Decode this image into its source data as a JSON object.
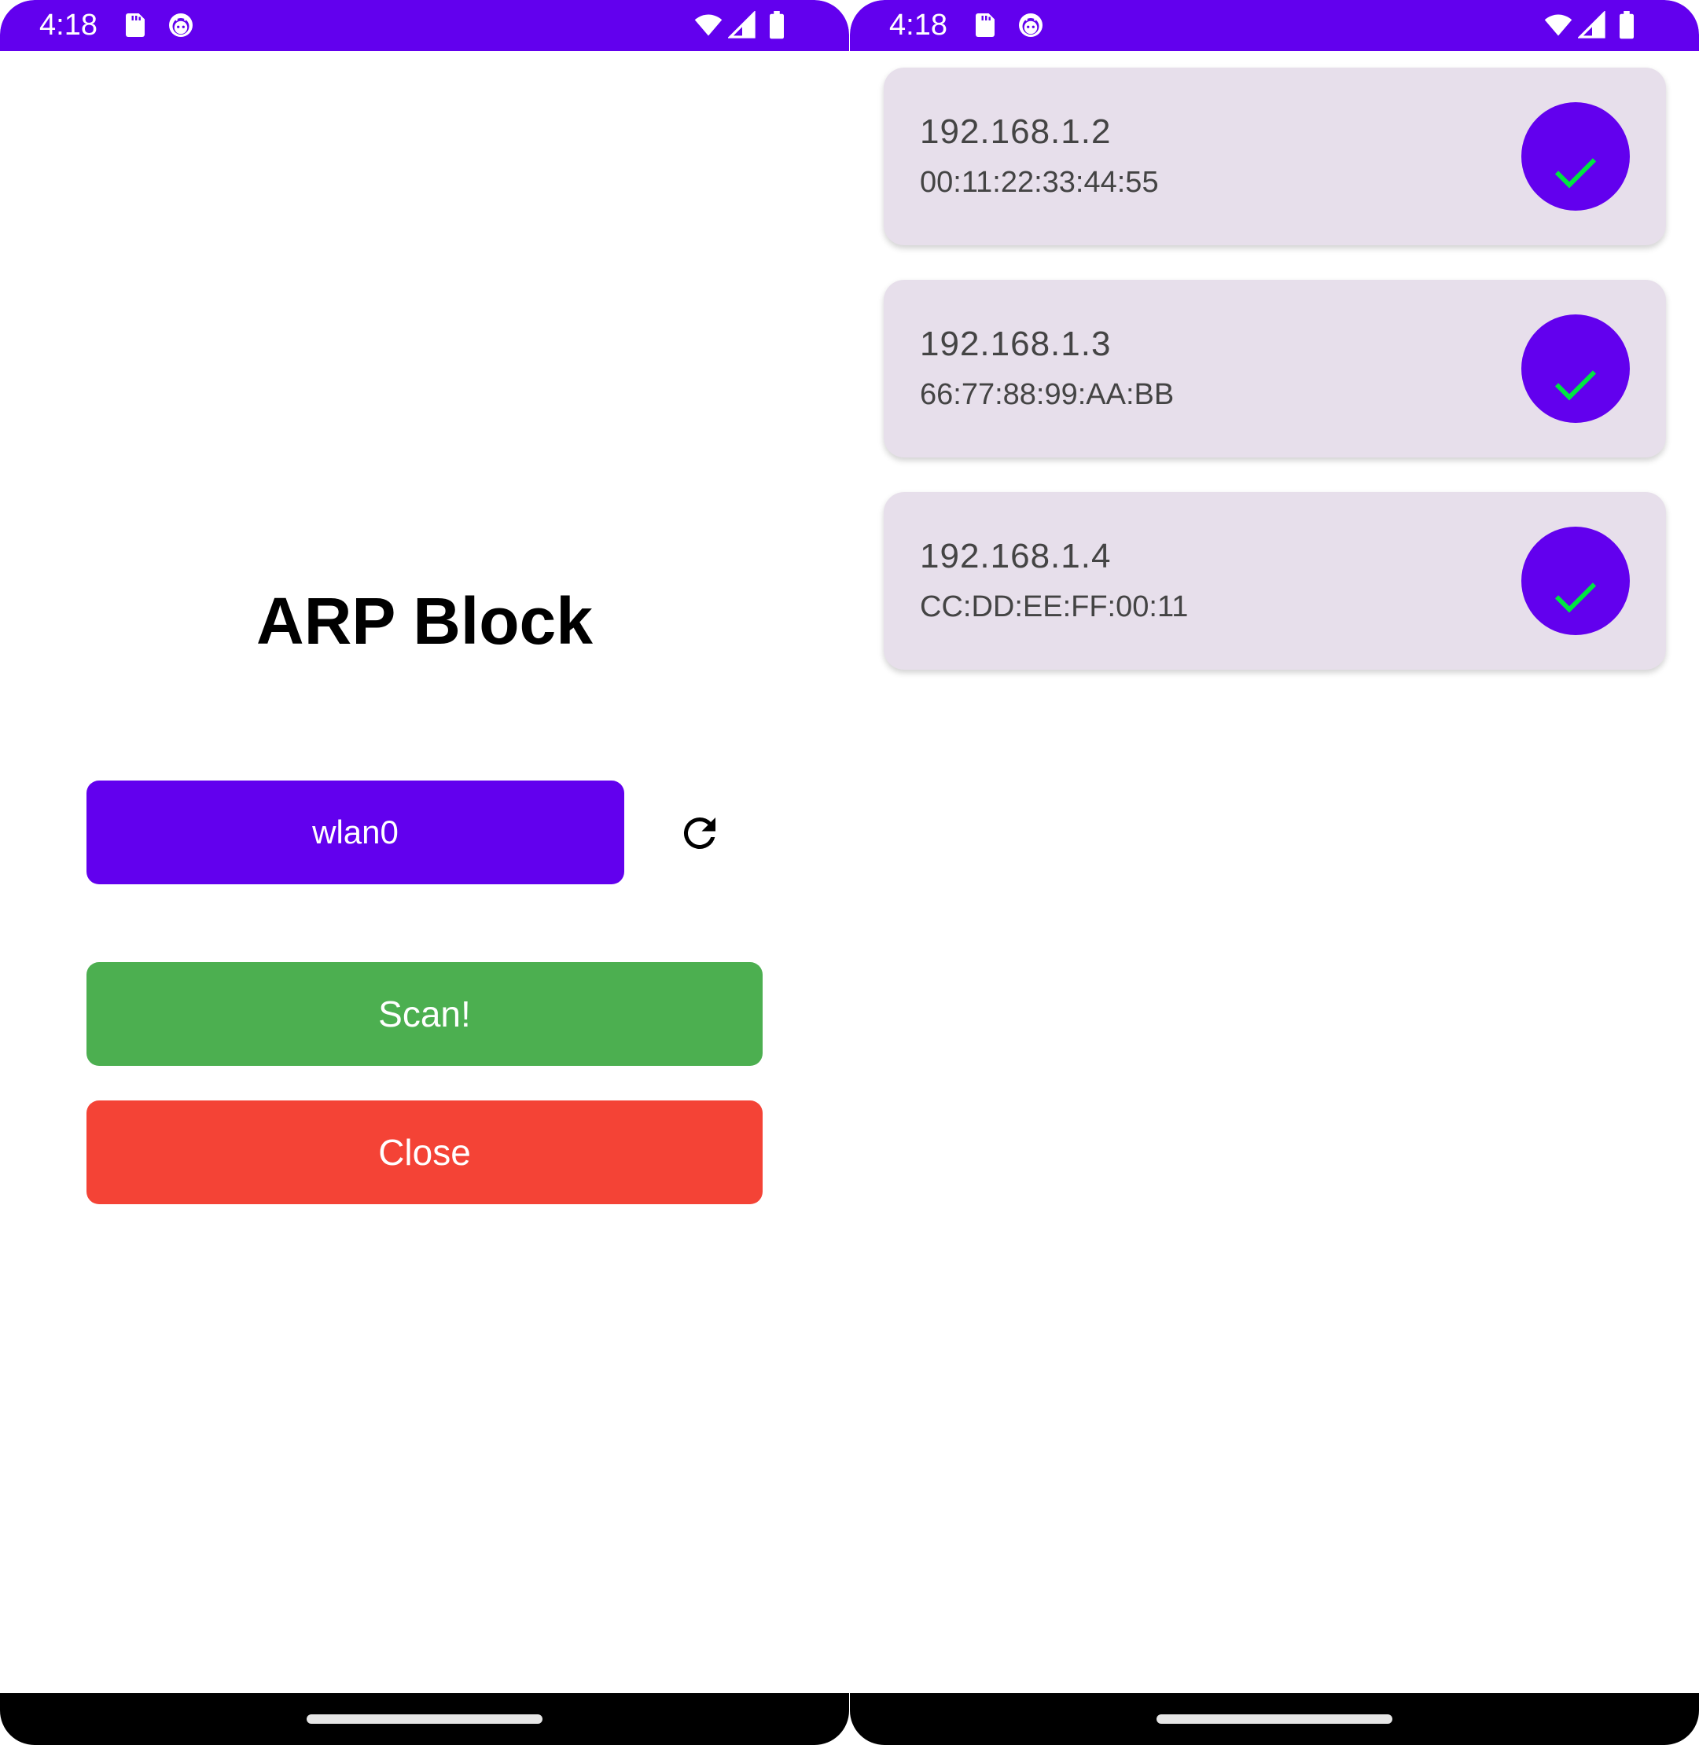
{
  "colors": {
    "primary": "#6200ee",
    "scan": "#4caf50",
    "close": "#f44336",
    "card": "#e7dfeb",
    "check": "#00e640"
  },
  "left_screen": {
    "status_bar": {
      "time": "4:18",
      "icons": [
        "sd-card-icon",
        "android-debug-icon",
        "wifi-icon",
        "cell-signal-icon",
        "battery-icon"
      ]
    },
    "title": "ARP Block",
    "interface_button": "wlan0",
    "refresh_icon": "refresh-icon",
    "scan_button": "Scan!",
    "close_button": "Close"
  },
  "right_screen": {
    "status_bar": {
      "time": "4:18",
      "icons": [
        "sd-card-icon",
        "android-debug-icon",
        "wifi-icon",
        "cell-signal-icon",
        "battery-icon"
      ]
    },
    "devices": [
      {
        "ip": "192.168.1.2",
        "mac": "00:11:22:33:44:55",
        "status_icon": "check-icon"
      },
      {
        "ip": "192.168.1.3",
        "mac": "66:77:88:99:AA:BB",
        "status_icon": "check-icon"
      },
      {
        "ip": "192.168.1.4",
        "mac": "CC:DD:EE:FF:00:11",
        "status_icon": "check-icon"
      }
    ]
  }
}
